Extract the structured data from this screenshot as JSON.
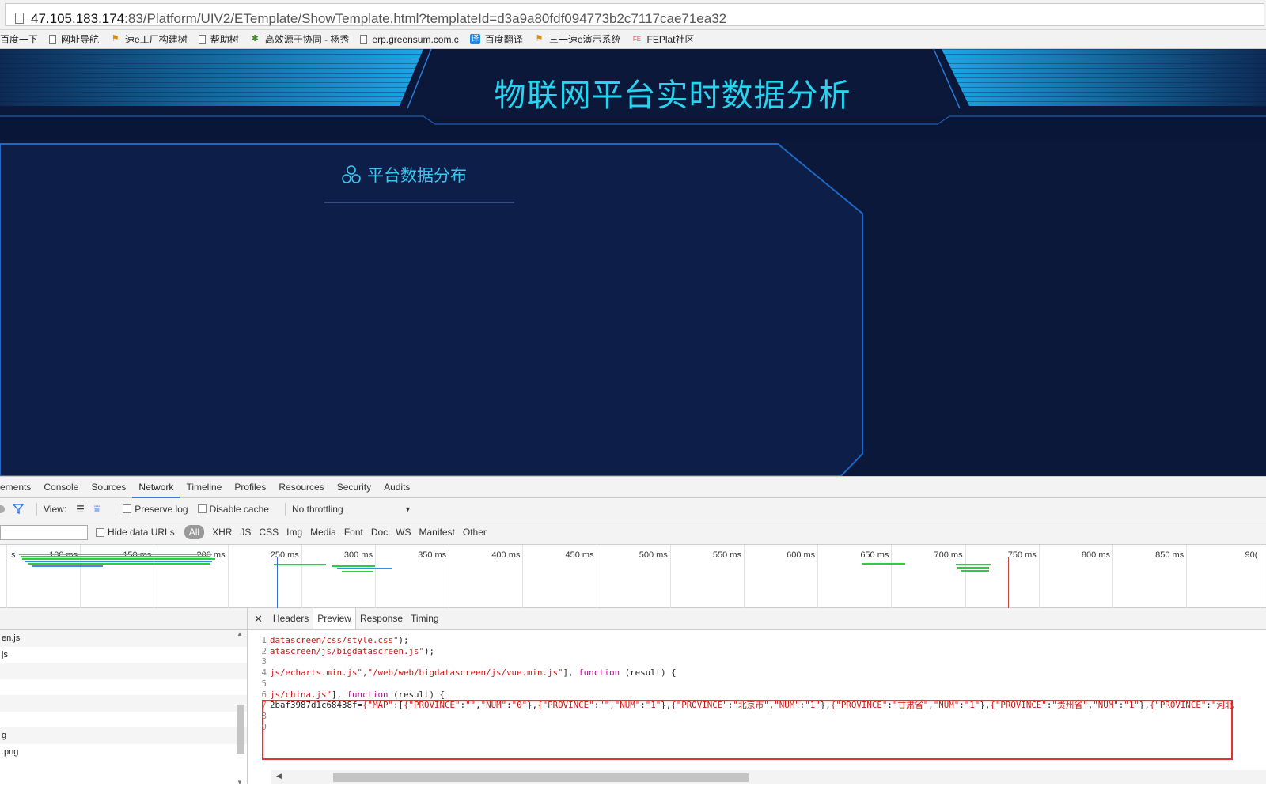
{
  "address_bar": {
    "url_host": "47.105.183.174",
    "url_rest": ":83/Platform/UIV2/ETemplate/ShowTemplate.html?templateId=d3a9a80fdf094773b2c7117cae71ea32"
  },
  "bookmarks": [
    {
      "label": "百度一下",
      "icon": "none"
    },
    {
      "label": "网址导航",
      "icon": "page-icon"
    },
    {
      "label": "速e工厂构建树",
      "icon": "flag-icon"
    },
    {
      "label": "帮助树",
      "icon": "page-icon"
    },
    {
      "label": "高效源于协同 - 杨秀",
      "icon": "star-icon"
    },
    {
      "label": "erp.greensum.com.c",
      "icon": "page-icon"
    },
    {
      "label": "百度翻译",
      "icon": "translate-icon"
    },
    {
      "label": "三一速e演示系统",
      "icon": "flag-icon"
    },
    {
      "label": "FEPlat社区",
      "icon": "feplat-icon"
    }
  ],
  "dashboard": {
    "title": "物联网平台实时数据分析",
    "panel_title": "平台数据分布",
    "colors": {
      "background": "#0b1a3a",
      "title": "#27d3ef",
      "panel_border": "#1f67c4"
    }
  },
  "devtools": {
    "tabs": [
      "ements",
      "Console",
      "Sources",
      "Network",
      "Timeline",
      "Profiles",
      "Resources",
      "Security",
      "Audits"
    ],
    "active_tab": "Network",
    "toolbar": {
      "view_label": "View:",
      "preserve_log": "Preserve log",
      "disable_cache": "Disable cache",
      "throttling": "No throttling"
    },
    "filter": {
      "hide_data_urls": "Hide data URLs",
      "types": [
        "All",
        "XHR",
        "JS",
        "CSS",
        "Img",
        "Media",
        "Font",
        "Doc",
        "WS",
        "Manifest",
        "Other"
      ],
      "active_type": "All"
    },
    "timeline_ticks": [
      "s",
      "100 ms",
      "150 ms",
      "200 ms",
      "250 ms",
      "300 ms",
      "350 ms",
      "400 ms",
      "450 ms",
      "500 ms",
      "550 ms",
      "600 ms",
      "650 ms",
      "700 ms",
      "750 ms",
      "800 ms",
      "850 ms",
      "90("
    ],
    "requests": [
      "en.js",
      "js",
      "",
      "",
      "",
      "",
      "g",
      ".png"
    ],
    "preview_tabs": [
      "Headers",
      "Preview",
      "Response",
      "Timing"
    ],
    "active_preview_tab": "Preview",
    "code_lines": [
      {
        "n": "1",
        "parts": [
          {
            "t": "datascreen/css/style.css\"",
            "c": "s"
          },
          {
            "t": ");",
            "c": "p"
          }
        ]
      },
      {
        "n": "2",
        "parts": [
          {
            "t": "atascreen/js/bigdatascreen.js\"",
            "c": "s"
          },
          {
            "t": ");",
            "c": "p"
          }
        ]
      },
      {
        "n": "3",
        "parts": []
      },
      {
        "n": "4",
        "parts": [
          {
            "t": "js/echarts.min.js\"",
            "c": "s"
          },
          {
            "t": ",",
            "c": "p"
          },
          {
            "t": "\"/web/web/bigdatascreen/js/vue.min.js\"",
            "c": "s"
          },
          {
            "t": "], ",
            "c": "p"
          },
          {
            "t": "function",
            "c": "k"
          },
          {
            "t": " (result) {",
            "c": "p"
          }
        ]
      },
      {
        "n": "5",
        "parts": []
      },
      {
        "n": "6",
        "parts": [
          {
            "t": "js/china.js\"",
            "c": "s"
          },
          {
            "t": "], ",
            "c": "p"
          },
          {
            "t": "function",
            "c": "k"
          },
          {
            "t": " (result) {",
            "c": "p"
          }
        ]
      },
      {
        "n": "7",
        "parts": [
          {
            "t": "2baf3987d1c68438f=",
            "c": "p"
          },
          {
            "t": "{\"MAP\"",
            "c": "s"
          },
          {
            "t": ":[",
            "c": "p"
          },
          {
            "t": "{\"PROVINCE\"",
            "c": "s"
          },
          {
            "t": ":",
            "c": "p"
          },
          {
            "t": "\"\"",
            "c": "s"
          },
          {
            "t": ",",
            "c": "p"
          },
          {
            "t": "\"NUM\"",
            "c": "s"
          },
          {
            "t": ":",
            "c": "p"
          },
          {
            "t": "\"0\"",
            "c": "s"
          },
          {
            "t": "},",
            "c": "p"
          },
          {
            "t": "{\"PROVINCE\"",
            "c": "s"
          },
          {
            "t": ":",
            "c": "p"
          },
          {
            "t": "\"\"",
            "c": "s"
          },
          {
            "t": ",",
            "c": "p"
          },
          {
            "t": "\"NUM\"",
            "c": "s"
          },
          {
            "t": ":",
            "c": "p"
          },
          {
            "t": "\"1\"",
            "c": "s"
          },
          {
            "t": "},",
            "c": "p"
          },
          {
            "t": "{\"PROVINCE\"",
            "c": "s"
          },
          {
            "t": ":",
            "c": "p"
          },
          {
            "t": "\"北京市\"",
            "c": "s"
          },
          {
            "t": ",",
            "c": "p"
          },
          {
            "t": "\"NUM\"",
            "c": "s"
          },
          {
            "t": ":",
            "c": "p"
          },
          {
            "t": "\"1\"",
            "c": "s"
          },
          {
            "t": "},",
            "c": "p"
          },
          {
            "t": "{\"PROVINCE\"",
            "c": "s"
          },
          {
            "t": ":",
            "c": "p"
          },
          {
            "t": "\"甘肃省\"",
            "c": "s"
          },
          {
            "t": ",",
            "c": "p"
          },
          {
            "t": "\"NUM\"",
            "c": "s"
          },
          {
            "t": ":",
            "c": "p"
          },
          {
            "t": "\"1\"",
            "c": "s"
          },
          {
            "t": "},",
            "c": "p"
          },
          {
            "t": "{\"PROVINCE\"",
            "c": "s"
          },
          {
            "t": ":",
            "c": "p"
          },
          {
            "t": "\"贵州省\"",
            "c": "s"
          },
          {
            "t": ",",
            "c": "p"
          },
          {
            "t": "\"NUM\"",
            "c": "s"
          },
          {
            "t": ":",
            "c": "p"
          },
          {
            "t": "\"1\"",
            "c": "s"
          },
          {
            "t": "},",
            "c": "p"
          },
          {
            "t": "{\"PROVINCE\"",
            "c": "s"
          },
          {
            "t": ":",
            "c": "p"
          },
          {
            "t": "\"河北",
            "c": "s"
          }
        ]
      },
      {
        "n": "8",
        "parts": []
      },
      {
        "n": "9",
        "parts": []
      }
    ]
  }
}
